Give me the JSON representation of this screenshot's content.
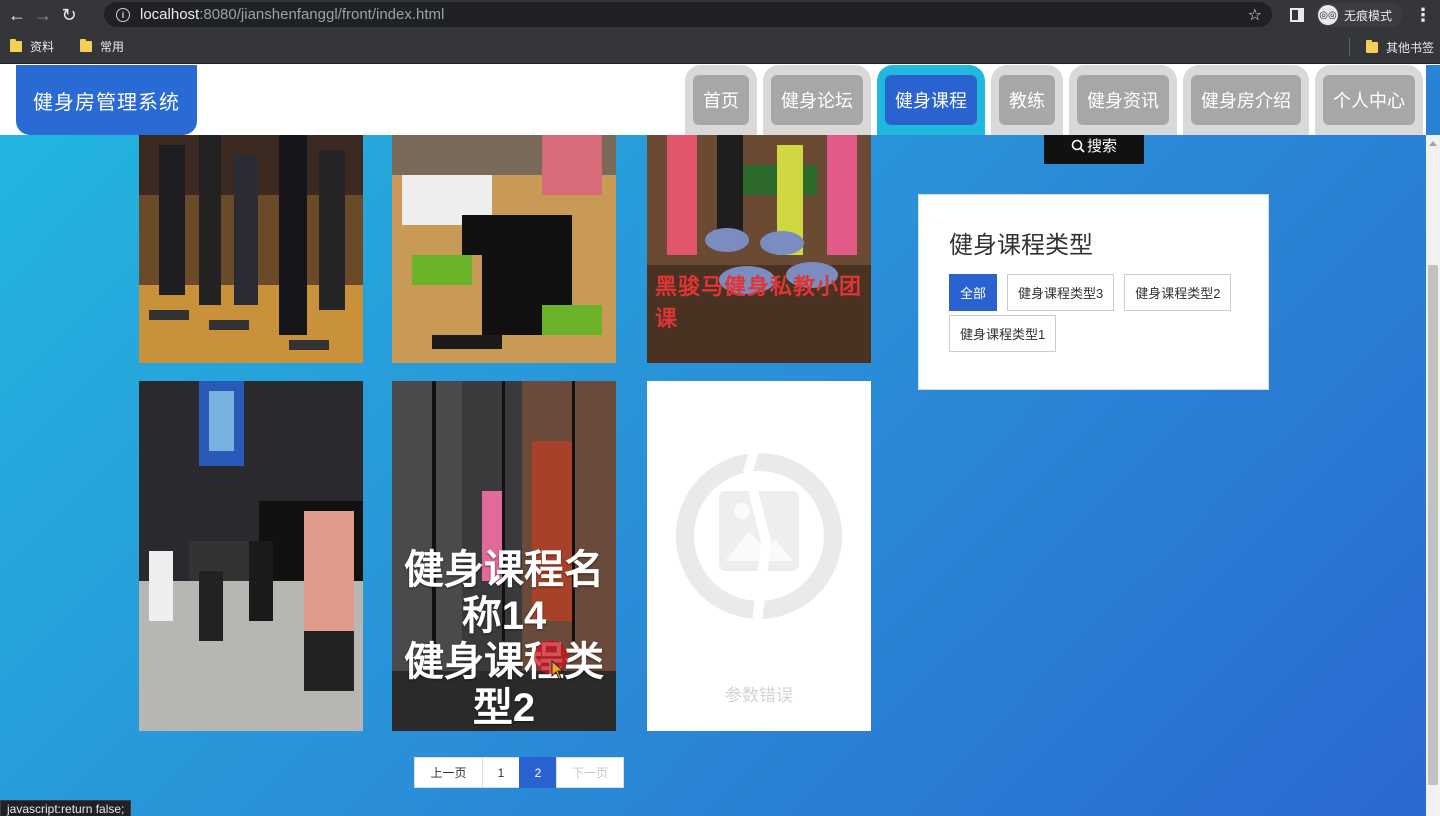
{
  "browser": {
    "url_host": "localhost",
    "url_path": ":8080/jianshenfanggl/front/index.html",
    "incognito_label": "无痕模式",
    "bookmarks": [
      {
        "label": "资料"
      },
      {
        "label": "常用"
      }
    ],
    "other_bookmarks": "其他书签",
    "status_text": "javascript:return false;"
  },
  "header": {
    "brand": "健身房管理系统",
    "nav": [
      {
        "label": "首页",
        "active": false
      },
      {
        "label": "健身论坛",
        "active": false
      },
      {
        "label": "健身课程",
        "active": true
      },
      {
        "label": "教练",
        "active": false
      },
      {
        "label": "健身资讯",
        "active": false
      },
      {
        "label": "健身房介绍",
        "active": false
      },
      {
        "label": "个人中心",
        "active": false
      }
    ]
  },
  "search": {
    "label": "搜索",
    "icon": "search-icon"
  },
  "courses": [
    {
      "caption": "",
      "image": "step-aerobics-class-photo"
    },
    {
      "caption": "",
      "image": "plank-on-step-photo"
    },
    {
      "caption": "",
      "watermark": "黑骏马健身私教小团课",
      "image": "bosu-ball-class-photo"
    },
    {
      "caption": "",
      "image": "gym-lunge-class-photo"
    },
    {
      "caption": "健身课程名称14\n健身课程类型2",
      "image": "trx-suspension-training-photo"
    },
    {
      "caption": "",
      "broken_label": "参数错误",
      "image": "broken-image-icon"
    }
  ],
  "categories": {
    "title": "健身课程类型",
    "items": [
      {
        "label": "全部",
        "active": true
      },
      {
        "label": "健身课程类型3",
        "active": false
      },
      {
        "label": "健身课程类型2",
        "active": false
      },
      {
        "label": "健身课程类型1",
        "active": false
      }
    ]
  },
  "pagination": {
    "prev": "上一页",
    "pages": [
      "1",
      "2"
    ],
    "current": "2",
    "next": "下一页"
  },
  "colors": {
    "primary": "#2a62cf",
    "accent": "#21b8df"
  }
}
